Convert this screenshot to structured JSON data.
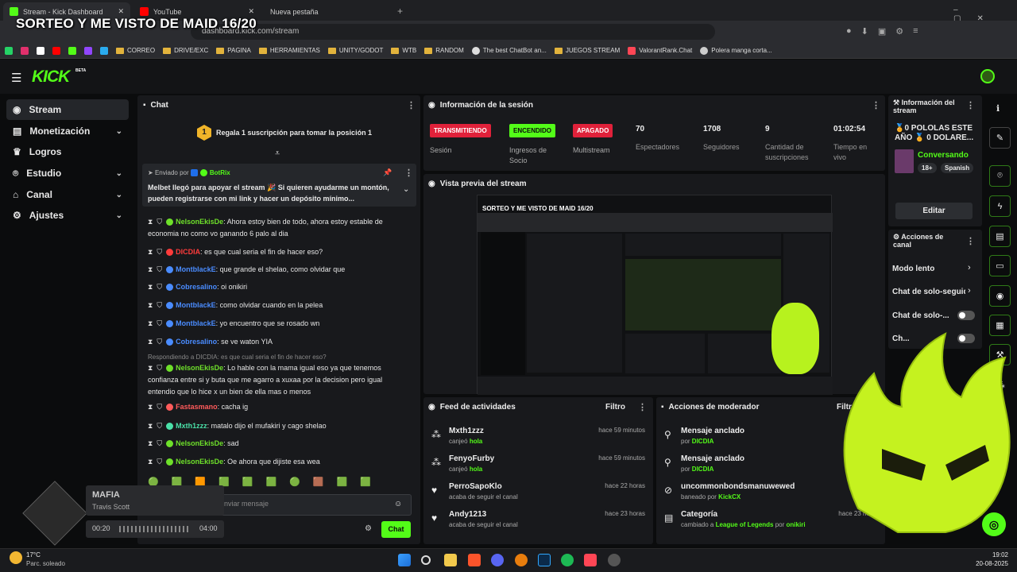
{
  "overlay_title": "SORTEO Y ME VISTO DE MAID 16/20",
  "browser": {
    "tabs": [
      {
        "title": "Stream - Kick Dashboard",
        "active": true
      },
      {
        "title": "YouTube",
        "active": false
      },
      {
        "title": "Nueva pestaña",
        "active": false
      }
    ],
    "url": "dashboard.kick.com/stream",
    "bookmarks": [
      "CORREO",
      "DRIVE/EXC",
      "PAGINA",
      "HERRAMIENTAS",
      "UNITY/GODOT",
      "WTB",
      "RANDOM",
      "The best ChatBot an...",
      "JUEGOS STREAM",
      "ValorantRank.Chat",
      "Polera manga corta..."
    ]
  },
  "app": {
    "logo": "KICK",
    "logo_badge": "BETA",
    "sidebar": [
      {
        "label": "Stream",
        "selected": true,
        "icon": "broadcast-icon"
      },
      {
        "label": "Monetización",
        "icon": "money-icon",
        "expand": true
      },
      {
        "label": "Logros",
        "icon": "trophy-icon"
      },
      {
        "label": "Estudio",
        "icon": "studio-icon",
        "expand": true
      },
      {
        "label": "Canal",
        "icon": "channel-icon",
        "expand": true
      },
      {
        "label": "Ajustes",
        "icon": "gear-icon",
        "expand": true
      }
    ]
  },
  "chat": {
    "title": "Chat",
    "sub_banner": "Regala 1 suscripción para tomar la posición 1",
    "sub_position": "1",
    "pinned": {
      "sent_by_label": "Enviado por",
      "sender": "BotRix",
      "message": "Melbet llegó para apoyar el stream 🎉 Si quieren ayudarme un montón, pueden registrarse con mi link y hacer un depósito mínimo..."
    },
    "messages": [
      {
        "user": "NelsonEkisDe",
        "color": "#6ee02a",
        "text": ": Ahora estoy bien de todo, ahora estoy estable de economia no como vo ganando 6 palo al dia"
      },
      {
        "user": "DICDIA",
        "color": "#ff3b3b",
        "text": ": es que cual seria el fin de hacer eso?"
      },
      {
        "user": "MontblackE",
        "color": "#4a8cff",
        "text": ": que grande el shelao, como olvidar que"
      },
      {
        "user": "Cobresalino",
        "color": "#4a8cff",
        "text": ": oi onikiri"
      },
      {
        "user": "MontblackE",
        "color": "#4a8cff",
        "text": ": como olvidar cuando en la pelea"
      },
      {
        "user": "MontblackE",
        "color": "#4a8cff",
        "text": ": yo encuentro que se rosado wn"
      },
      {
        "user": "Cobresalino",
        "color": "#4a8cff",
        "text": ": se ve waton YIA"
      },
      {
        "user": "NelsonEkisDe",
        "color": "#6ee02a",
        "reply": "Respondiendo a DICDIA: es que cual seria el fin de hacer eso?",
        "text": ": Lo hable con la mama igual eso ya que tenemos confianza entre si y buta que me agarro a xuxaa por la decision pero igual entendio que lo hice x un bien de ella mas o menos"
      },
      {
        "user": "Fastasmano",
        "color": "#ff5b5b",
        "text": ": cacha ig"
      },
      {
        "user": "Mxth1zzz",
        "color": "#4ae0a8",
        "text": ": matalo dijo el mufakiri y cago shelao"
      },
      {
        "user": "NelsonEkisDe",
        "color": "#6ee02a",
        "text": ": sad"
      },
      {
        "user": "NelsonEkisDe",
        "color": "#6ee02a",
        "text": ": Oe ahora que dijiste esa wea"
      }
    ],
    "input_placeholder": "Enviar mensaje",
    "send_label": "Chat"
  },
  "session": {
    "title": "Información de la sesión",
    "badges": [
      {
        "text": "TRANSMITIENDO",
        "label": "Sesión",
        "color": "#e0213a",
        "text_color": "#ffffff"
      },
      {
        "text": "ENCENDIDO",
        "label": "Ingresos de Socio",
        "color": "#53fc18",
        "text_color": "#0b0c0d"
      },
      {
        "text": "APAGADO",
        "label": "Multistream",
        "color": "#e0213a",
        "text_color": "#ffffff"
      }
    ],
    "stats": [
      {
        "value": "70",
        "label": "Espectadores"
      },
      {
        "value": "1708",
        "label": "Seguidores"
      },
      {
        "value": "9",
        "label": "Cantidad de suscripciones"
      },
      {
        "value": "01:02:54",
        "label": "Tiempo en vivo"
      }
    ]
  },
  "preview": {
    "title": "Vista previa del stream"
  },
  "stream_info": {
    "title": "Información del stream",
    "stream_title": "🏅0 POLOLAS ESTE AÑO 🏅 0 DOLARE...",
    "category": "Conversando",
    "tags": [
      "18+",
      "Spanish"
    ],
    "edit_label": "Editar"
  },
  "channel_actions": {
    "title": "Acciones de canal",
    "items": [
      {
        "label": "Modo lento",
        "kind": "arrow"
      },
      {
        "label": "Chat de solo-seguid",
        "kind": "arrow"
      },
      {
        "label": "Chat de solo-...",
        "kind": "toggle"
      },
      {
        "label": "Ch...",
        "kind": "toggle"
      }
    ]
  },
  "activity_feed": {
    "title": "Feed de actividades",
    "filter_label": "Filtro",
    "items": [
      {
        "name": "Mxth1zzz",
        "action": "canjeó",
        "detail": "hola",
        "time": "hace 59 minutos",
        "icon": "redeem-icon"
      },
      {
        "name": "FenyoFurby",
        "action": "canjeó",
        "detail": "hola",
        "time": "hace 59 minutos",
        "icon": "redeem-icon"
      },
      {
        "name": "PerroSapoKlo",
        "action": "acaba de seguir el canal",
        "detail": "",
        "time": "hace 22 horas",
        "icon": "heart-icon"
      },
      {
        "name": "Andy1213",
        "action": "acaba de seguir el canal",
        "detail": "",
        "time": "hace 23 horas",
        "icon": "heart-icon"
      }
    ]
  },
  "mod_actions": {
    "title": "Acciones de moderador",
    "filter_label": "Filtro",
    "items": [
      {
        "name": "Mensaje anclado",
        "pre": "por",
        "who": "DICDIA",
        "time": "hace",
        "icon": "pin-icon"
      },
      {
        "name": "Mensaje anclado",
        "pre": "por",
        "who": "DICDIA",
        "time": "hace",
        "icon": "pin-icon"
      },
      {
        "name": "uncommonbondsmanuwewed",
        "pre": "baneado por",
        "who": "KickCX",
        "time": "hace",
        "icon": "ban-icon"
      },
      {
        "name": "Categoría",
        "pre": "cambiado a",
        "who": "League of Legends",
        "suffix": "por",
        "who2": "onikiri",
        "time": "hace 23 horas",
        "icon": "category-icon"
      }
    ]
  },
  "music_widget": {
    "song": "MAFIA",
    "artist": "Travis Scott",
    "elapsed": "00:20",
    "duration": "04:00",
    "progress": 0.08
  },
  "taskbar": {
    "weather_temp": "17°C",
    "weather_desc": "Parc. soleado",
    "time": "19:02",
    "date": "20-08-2025"
  },
  "colors": {
    "accent": "#53fc18",
    "live": "#e0213a",
    "panel": "#18191c",
    "bg": "#0b0c0d"
  }
}
